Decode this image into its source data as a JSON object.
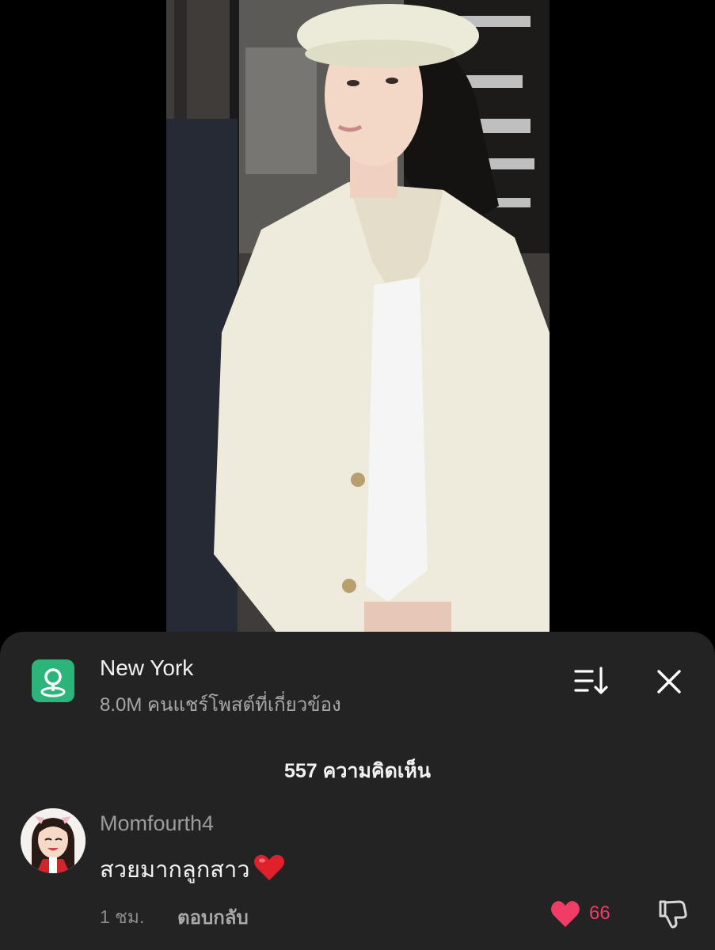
{
  "video": {
    "description_icon": "video-frame"
  },
  "header": {
    "place_icon": "location-pin-icon",
    "title": "New York",
    "subtitle": "8.0M คนแชร์โพสต์ที่เกี่ยวข้อง",
    "sort_icon": "sort-icon",
    "close_icon": "close-icon"
  },
  "comments_header": {
    "count_label": "557 ความคิดเห็น"
  },
  "comment": {
    "username": "Momfourth4",
    "text": "สวยมากลูกสาว",
    "emoji": "red-heart-emoji",
    "time": "1 ชม.",
    "reply_label": "ตอบกลับ",
    "like_count": "66",
    "liked": true,
    "like_color": "#f03c66"
  },
  "colors": {
    "sheet_bg": "#232323",
    "place_icon_bg": "#2bb57b",
    "accent": "#f03c66"
  }
}
